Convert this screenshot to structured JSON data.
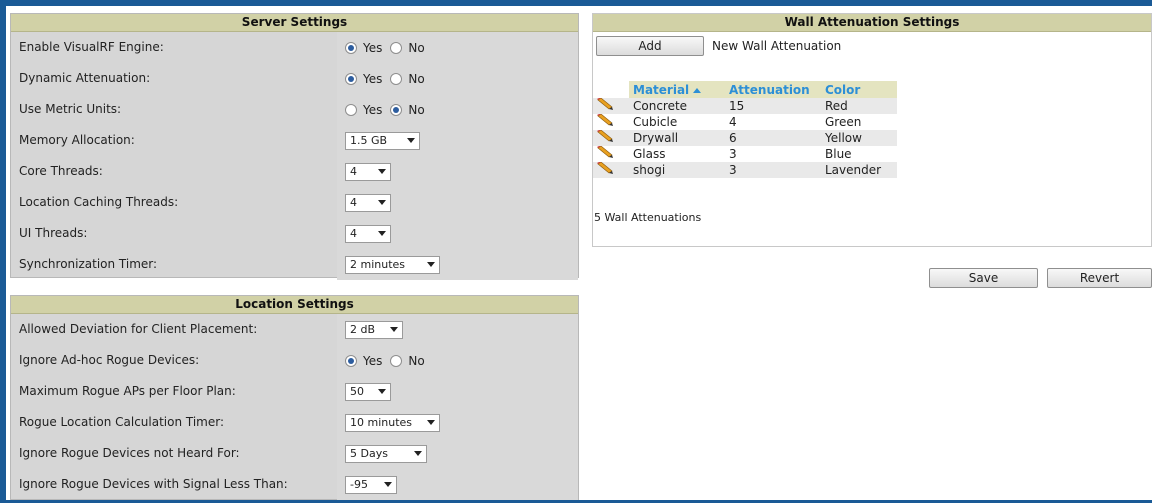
{
  "server": {
    "title": "Server Settings",
    "rows": [
      {
        "label": "Enable VisualRF Engine:",
        "type": "radio",
        "yes": "Yes",
        "no": "No",
        "value": "Yes"
      },
      {
        "label": "Dynamic Attenuation:",
        "type": "radio",
        "yes": "Yes",
        "no": "No",
        "value": "Yes"
      },
      {
        "label": "Use Metric Units:",
        "type": "radio",
        "yes": "Yes",
        "no": "No",
        "value": "No"
      },
      {
        "label": "Memory Allocation:",
        "type": "select",
        "value": "1.5 GB"
      },
      {
        "label": "Core Threads:",
        "type": "select",
        "value": "4"
      },
      {
        "label": "Location Caching Threads:",
        "type": "select",
        "value": "4"
      },
      {
        "label": "UI Threads:",
        "type": "select",
        "value": "4"
      },
      {
        "label": "Synchronization Timer:",
        "type": "select",
        "value": "2 minutes"
      }
    ]
  },
  "location": {
    "title": "Location Settings",
    "rows": [
      {
        "label": "Allowed Deviation for Client Placement:",
        "type": "select",
        "value": "2 dB"
      },
      {
        "label": "Ignore Ad-hoc Rogue Devices:",
        "type": "radio",
        "yes": "Yes",
        "no": "No",
        "value": "Yes"
      },
      {
        "label": "Maximum Rogue APs per Floor Plan:",
        "type": "select",
        "value": "50"
      },
      {
        "label": "Rogue Location Calculation Timer:",
        "type": "select",
        "value": "10 minutes"
      },
      {
        "label": "Ignore Rogue Devices not Heard For:",
        "type": "select",
        "value": "5 Days"
      },
      {
        "label": "Ignore Rogue Devices with Signal Less Than:",
        "type": "select",
        "value": "-95"
      }
    ]
  },
  "wall": {
    "title": "Wall Attenuation Settings",
    "add_label": "Add",
    "new_label": "New Wall Attenuation",
    "columns": [
      "Material",
      "Attenuation",
      "Color"
    ],
    "rows": [
      {
        "material": "Concrete",
        "attenuation": "15",
        "color": "Red"
      },
      {
        "material": "Cubicle",
        "attenuation": "4",
        "color": "Green"
      },
      {
        "material": "Drywall",
        "attenuation": "6",
        "color": "Yellow"
      },
      {
        "material": "Glass",
        "attenuation": "3",
        "color": "Blue"
      },
      {
        "material": "shogi",
        "attenuation": "3",
        "color": "Lavender"
      }
    ],
    "count_label": "5 Wall Attenuations"
  },
  "actions": {
    "save": "Save",
    "revert": "Revert"
  },
  "colors": {
    "frame": "#1a5a96",
    "header": "#d1d1a6",
    "panel": "#d6d6d6",
    "link": "#2d8fd6",
    "radio": "#2d5d9f"
  }
}
